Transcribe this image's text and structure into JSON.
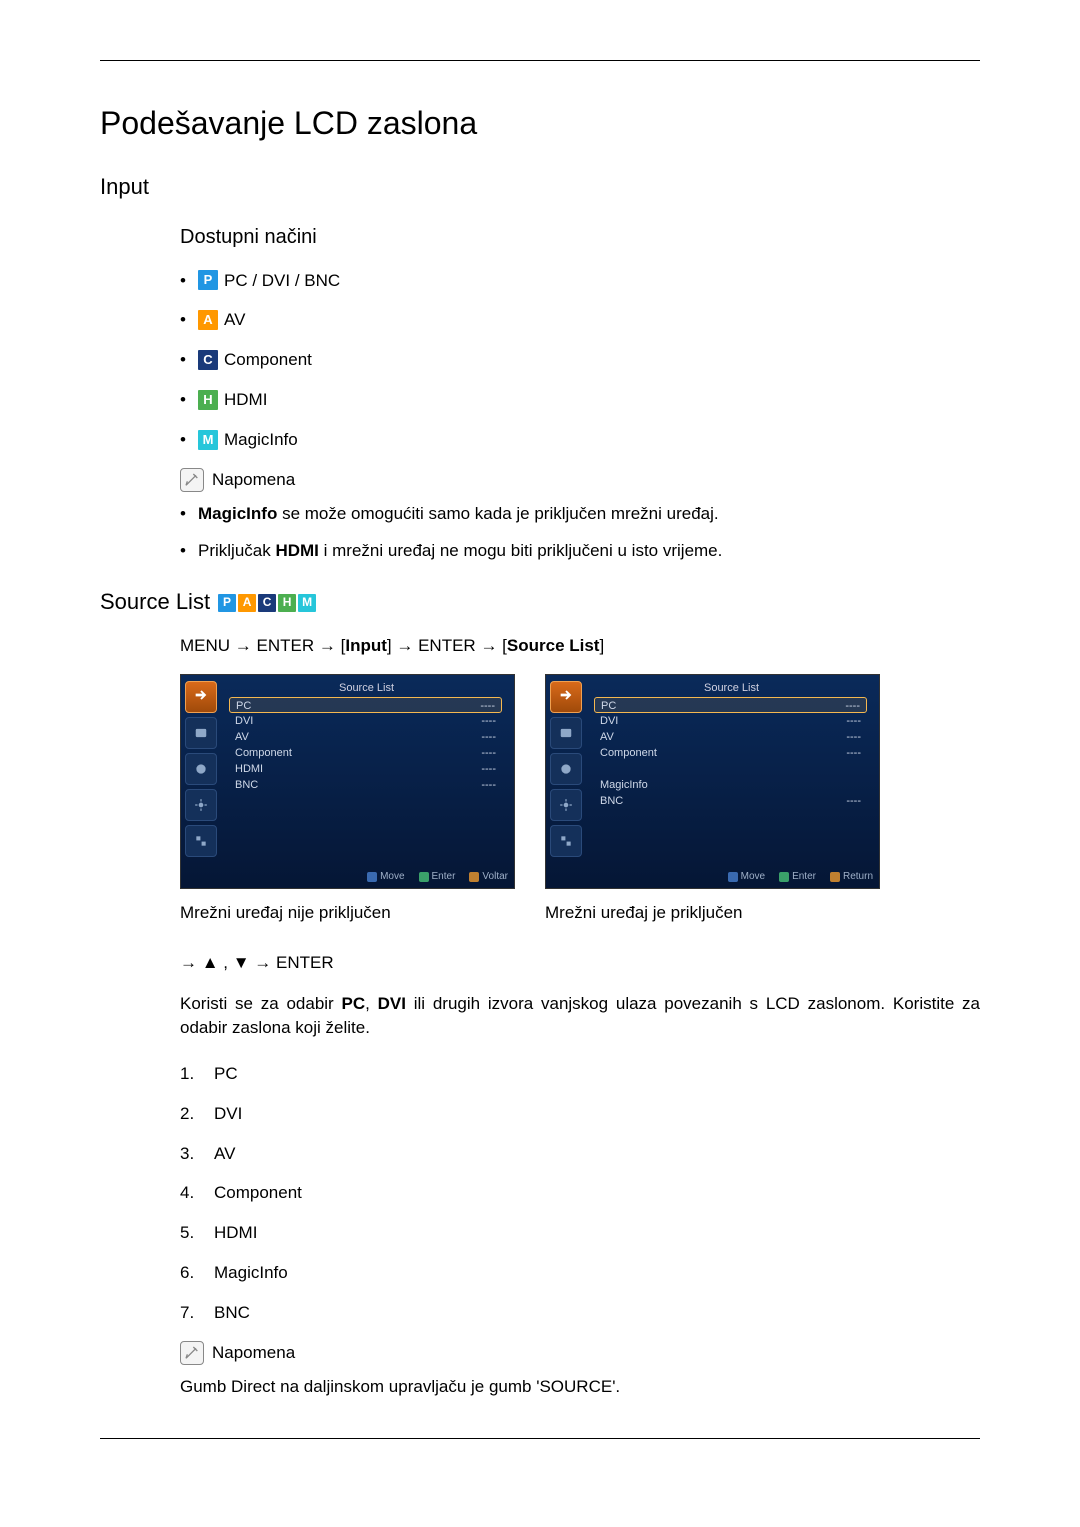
{
  "title": "Podešavanje LCD zaslona",
  "section_input": "Input",
  "modes_header": "Dostupni načini",
  "modes": [
    {
      "badge": "P",
      "cls": "ib-p",
      "label": "PC / DVI / BNC"
    },
    {
      "badge": "A",
      "cls": "ib-a",
      "label": "AV"
    },
    {
      "badge": "C",
      "cls": "ib-c",
      "label": "Component"
    },
    {
      "badge": "H",
      "cls": "ib-h",
      "label": "HDMI"
    },
    {
      "badge": "M",
      "cls": "ib-m",
      "label": "MagicInfo"
    }
  ],
  "napomena": "Napomena",
  "notes": {
    "n1_bold": "MagicInfo",
    "n1_rest": " se može omogućiti samo kada je priključen mrežni uređaj.",
    "n2_pre": "Priključak ",
    "n2_bold": "HDMI",
    "n2_rest": " i mrežni uređaj ne mogu biti priključeni u isto vrijeme."
  },
  "source_list_header": "Source List",
  "menu_path": {
    "menu": "MENU",
    "enter": "ENTER",
    "arrow": "→",
    "input": "Input",
    "source_list": "Source List"
  },
  "panel_title": "Source List",
  "panel_left_items": [
    {
      "name": "PC",
      "val": "----",
      "hl": true
    },
    {
      "name": "DVI",
      "val": "----"
    },
    {
      "name": "AV",
      "val": "----"
    },
    {
      "name": "Component",
      "val": "----"
    },
    {
      "name": "HDMI",
      "val": "----"
    },
    {
      "name": "BNC",
      "val": "----"
    }
  ],
  "panel_right_items": [
    {
      "name": "PC",
      "val": "----",
      "hl": true
    },
    {
      "name": "DVI",
      "val": "----"
    },
    {
      "name": "AV",
      "val": "----"
    },
    {
      "name": "Component",
      "val": "----"
    },
    {
      "name": "",
      "val": ""
    },
    {
      "name": "MagicInfo",
      "val": ""
    },
    {
      "name": "BNC",
      "val": "----"
    }
  ],
  "panel_footer": {
    "move": "Move",
    "enter": "Enter",
    "return_left": "Voltar",
    "return_right": "Return"
  },
  "caption_left": "Mrežni uređaj nije priključen",
  "caption_right": "Mrežni uređaj je priključen",
  "nav_line": {
    "arrow": "→",
    "up": "▲",
    "comma": " , ",
    "down": "▼",
    "enter": "ENTER"
  },
  "para": {
    "pre": "Koristi se za odabir ",
    "b1": "PC",
    "mid1": ", ",
    "b2": "DVI",
    "rest": " ili drugih izvora vanjskog ulaza povezanih s LCD zaslonom. Koristite za odabir zaslona koji želite."
  },
  "ordered": [
    "PC",
    "DVI",
    "AV",
    "Component",
    "HDMI",
    "MagicInfo",
    "BNC"
  ],
  "footer_text": "Gumb Direct na daljinskom upravljaču je gumb 'SOURCE'."
}
